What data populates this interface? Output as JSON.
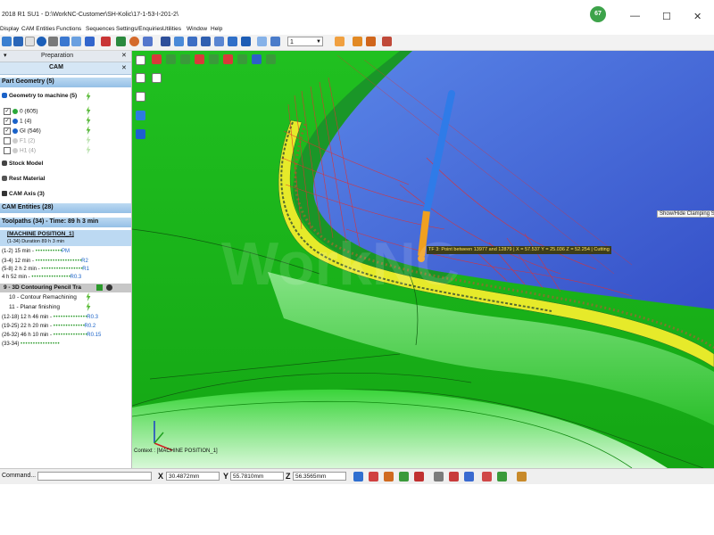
{
  "app": {
    "title": "2018 R1 SU1 - D:\\WorkNC-Customer\\SH-Kolic\\17-1-53-I-201-2\\",
    "badge": "67"
  },
  "menu": [
    "Display",
    "CAM Entities",
    "Functions",
    "Sequences",
    "Settings/Enquiries",
    "Utilities",
    "Window",
    "Help"
  ],
  "toolbar": {
    "combo_value": "1"
  },
  "panel": {
    "header": "Preparation",
    "tab": "CAM",
    "part_geometry": {
      "label": "Part Geometry (5)",
      "geometry_to_machine": "Geometry to machine (5)",
      "items": [
        {
          "label": "0 (605)",
          "checked": true,
          "color": "#2aa83a",
          "gray": false
        },
        {
          "label": "1 (4)",
          "checked": true,
          "color": "#1a62c8",
          "gray": false
        },
        {
          "label": "GI (546)",
          "checked": true,
          "color": "#1a62c8",
          "gray": false
        },
        {
          "label": "F1 (2)",
          "checked": false,
          "color": "#bbbbbb",
          "gray": true
        },
        {
          "label": "H1 (4)",
          "checked": false,
          "color": "#bbbbbb",
          "gray": true
        }
      ]
    },
    "stock_model": "Stock Model",
    "rest_material": "Rest Material",
    "cam_axis": "CAM Axis (3)",
    "cam_entities": "CAM Entities (28)",
    "toolpaths": {
      "label": "Toolpaths (34) - Time: 89 h 3 min",
      "machine_position": "[MACHINE POSITION_1]",
      "duration": "(1-34) Duration 89 h 3 min",
      "rows": [
        {
          "left": "(1-2) 15 min - ",
          "dashes": "• • • • • • • • • • •",
          "tag": "PM"
        },
        {
          "left": "(3-4) 12 min - ",
          "dashes": "• • • • • • • • • • • • • • • • • • •",
          "tag": "R2"
        },
        {
          "left": "(5-8) 2 h 2 min - ",
          "dashes": "• • • • • • • • • • • • • • • • •",
          "tag": "R1"
        },
        {
          "left": "4 h 52 min - ",
          "dashes": "• • • • • • • • • • • • • • • •",
          "tag": "R0.3"
        }
      ],
      "selected": "9 - 3D Contouring Pencil Tra",
      "sub_items": [
        "10 - Contour Remachining",
        "11 - Planar finishing"
      ],
      "rows2": [
        {
          "left": "(12-18) 12 h 46 min - ",
          "dashes": "• • • • • • • • • • • • • •",
          "tag": "R0.3"
        },
        {
          "left": "(19-25) 22 h 20 min - ",
          "dashes": "• • • • • • • • • • • • •",
          "tag": "R0.2"
        },
        {
          "left": "(26-32) 46 h 10 min - ",
          "dashes": "• • • • • • • • • • • • • •",
          "tag": "R0.15"
        },
        {
          "left": "(33-34) ",
          "dashes": "• • • • • • • • • • • • • • • •",
          "tag": ""
        }
      ]
    }
  },
  "viewport": {
    "tooltip": "TF 3: Point between 13977 and 12879 | X = 57.537   Y = 25.036   Z = 52.254 | Cutting",
    "side_tooltip": "Show/Hide Clamping Syst",
    "status": "Context : [MACHINE POSITION_1]"
  },
  "command": {
    "label": "Command...",
    "x_label": "X",
    "x_value": "30.4872mm",
    "y_label": "Y",
    "y_value": "55.7810mm",
    "z_label": "Z",
    "z_value": "56.3565mm"
  },
  "colors": {
    "surface_green": "#1ec41e",
    "sky_blue": "#3f64dc",
    "tool_blue": "#2f7be8",
    "tool_orange": "#f0a020"
  }
}
